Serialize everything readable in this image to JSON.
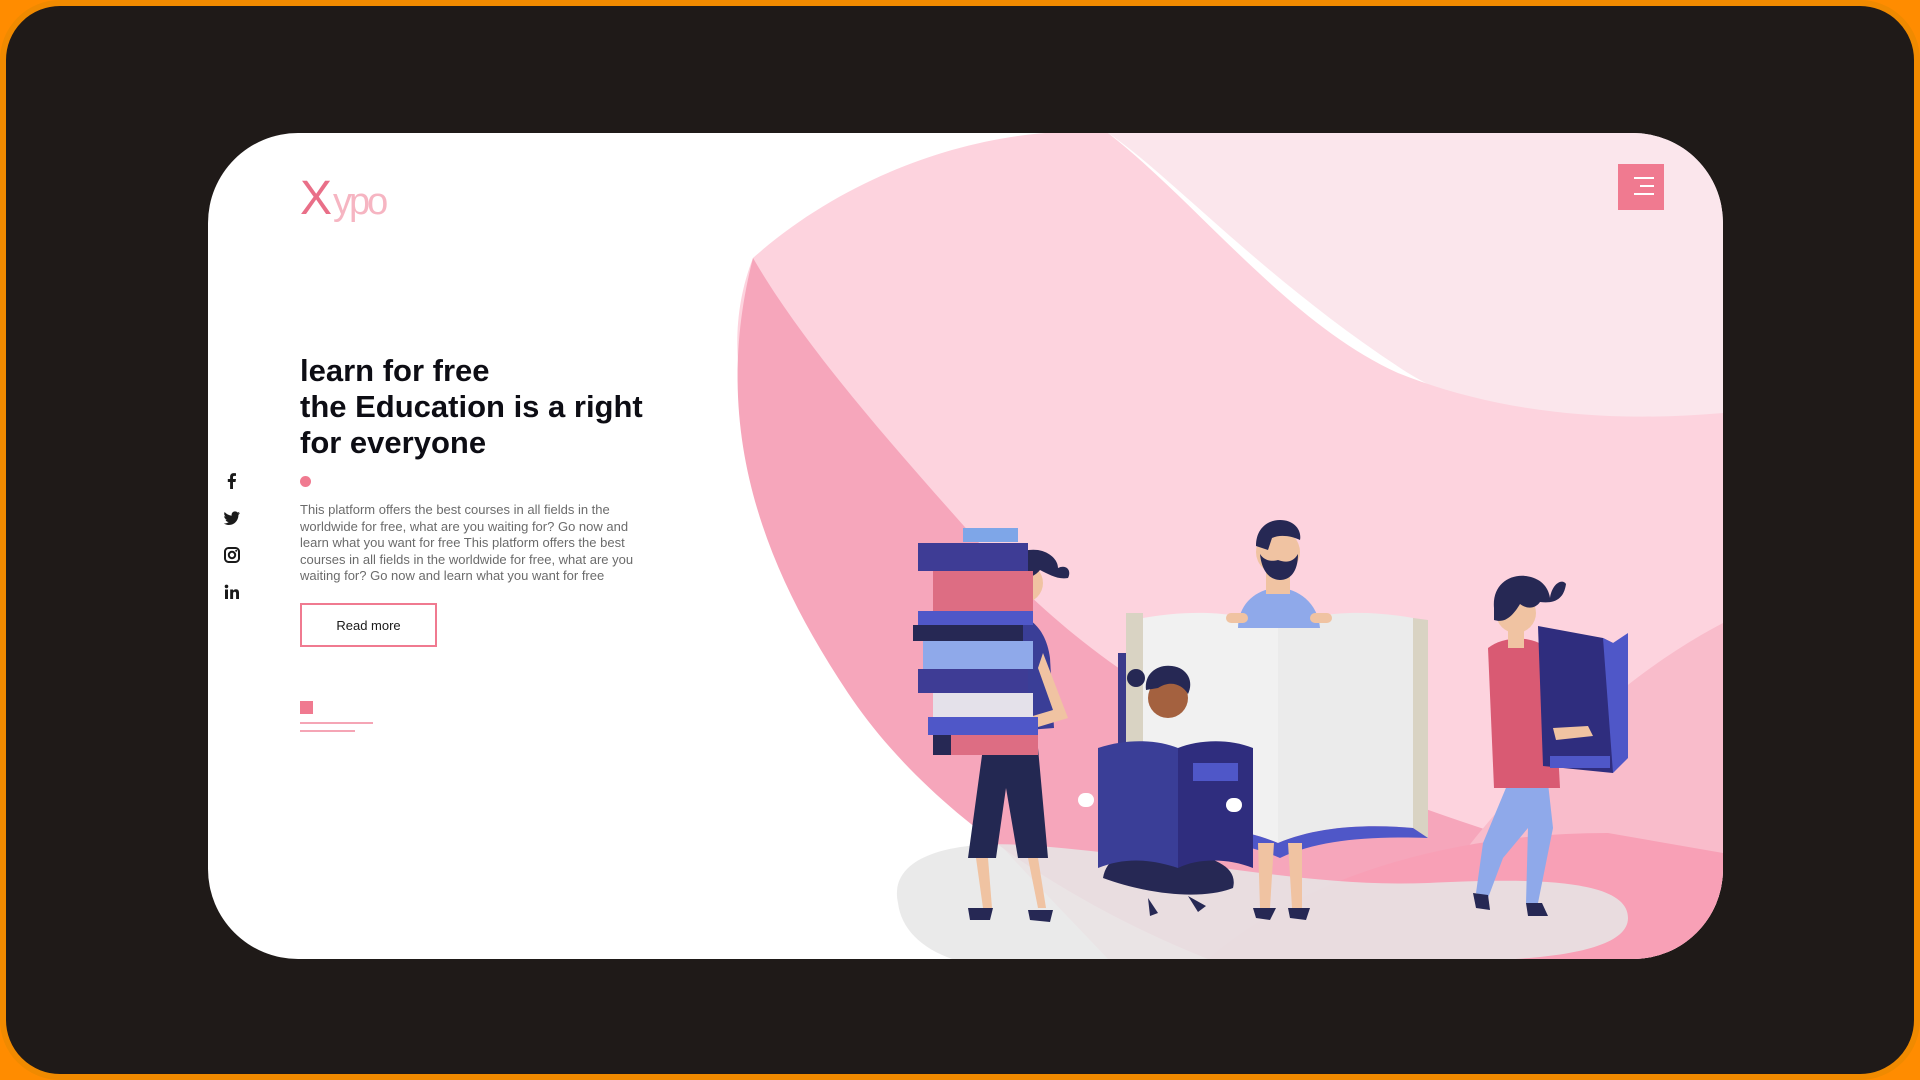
{
  "brand": {
    "logo_x": "X",
    "logo_rest": "ypo",
    "accent": "#f07a90"
  },
  "header": {
    "menu_icon": "hamburger-menu-icon"
  },
  "social": [
    {
      "name": "facebook-icon",
      "glyph": "f"
    },
    {
      "name": "twitter-icon"
    },
    {
      "name": "instagram-icon"
    },
    {
      "name": "linkedin-icon",
      "glyph": "in"
    }
  ],
  "hero": {
    "title_lines": [
      "learn for free",
      "the Education is a right",
      "for everyone"
    ],
    "description": "This platform offers the best courses in all fields in the worldwide for free, what are you waiting for? Go now and learn what you want for free This platform offers the best courses in all fields in the worldwide for free, what are you waiting for? Go now and learn what you want for free",
    "cta_label": "Read more"
  },
  "colors": {
    "frame": "#1f1a18",
    "frame_border": "#f08a00",
    "card": "#ffffff",
    "blob_light": "#fde4ea",
    "blob_mid": "#fcc9d5",
    "blob_dark": "#f79ab2",
    "navy": "#2f2d7e",
    "blue": "#4f57c8"
  }
}
